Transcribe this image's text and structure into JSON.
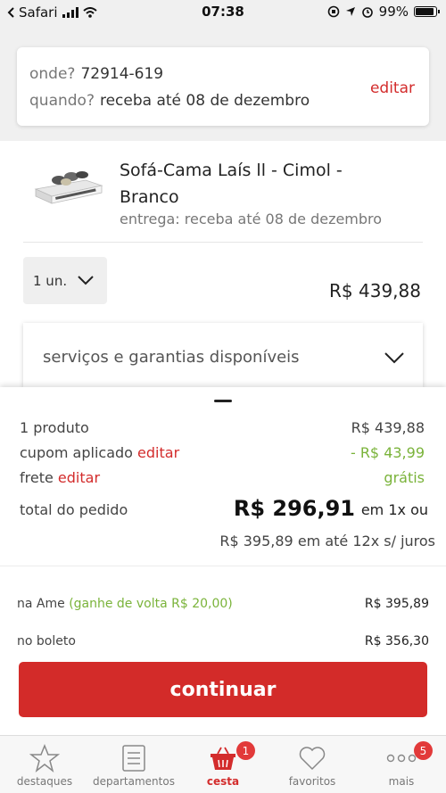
{
  "status_bar": {
    "carrier": "Safari",
    "time": "07:38",
    "battery": "99%"
  },
  "location": {
    "where_label": "onde?",
    "where_value": "72914-619",
    "when_label": "quando?",
    "when_value": "receba até 08 de dezembro",
    "edit_label": "editar"
  },
  "product": {
    "title": "Sofá-Cama Laís ll - Cimol - Branco",
    "delivery": "entrega: receba até 08 de dezembro",
    "quantity": "1 un.",
    "price": "R$ 439,88",
    "services_label": "serviços e garantias disponíveis"
  },
  "summary": {
    "products_label": "1 produto",
    "products_value": "R$ 439,88",
    "coupon_label": "cupom aplicado",
    "coupon_edit": "editar",
    "coupon_value": "- R$ 43,99",
    "shipping_label": "frete",
    "shipping_edit": "editar",
    "shipping_value": "grátis",
    "total_label": "total do pedido",
    "total_value": "R$ 296,91",
    "total_note": "em 1x ou",
    "installments": "R$ 395,89 em até 12x s/ juros"
  },
  "payment": {
    "ame_label": "na Ame",
    "ame_cashback": "(ganhe de volta R$ 20,00)",
    "ame_value": "R$ 395,89",
    "boleto_label": "no boleto",
    "boleto_value": "R$ 356,30",
    "continue_label": "continuar"
  },
  "tabbar": {
    "tabs": [
      {
        "label": "destaques",
        "icon": "star-icon"
      },
      {
        "label": "departamentos",
        "icon": "list-icon"
      },
      {
        "label": "cesta",
        "icon": "basket-icon",
        "badge": "1"
      },
      {
        "label": "favoritos",
        "icon": "heart-icon"
      },
      {
        "label": "mais",
        "icon": "more-icon",
        "badge": "5"
      }
    ]
  },
  "colors": {
    "accent_red": "#d32b29",
    "green": "#7ab33a"
  }
}
